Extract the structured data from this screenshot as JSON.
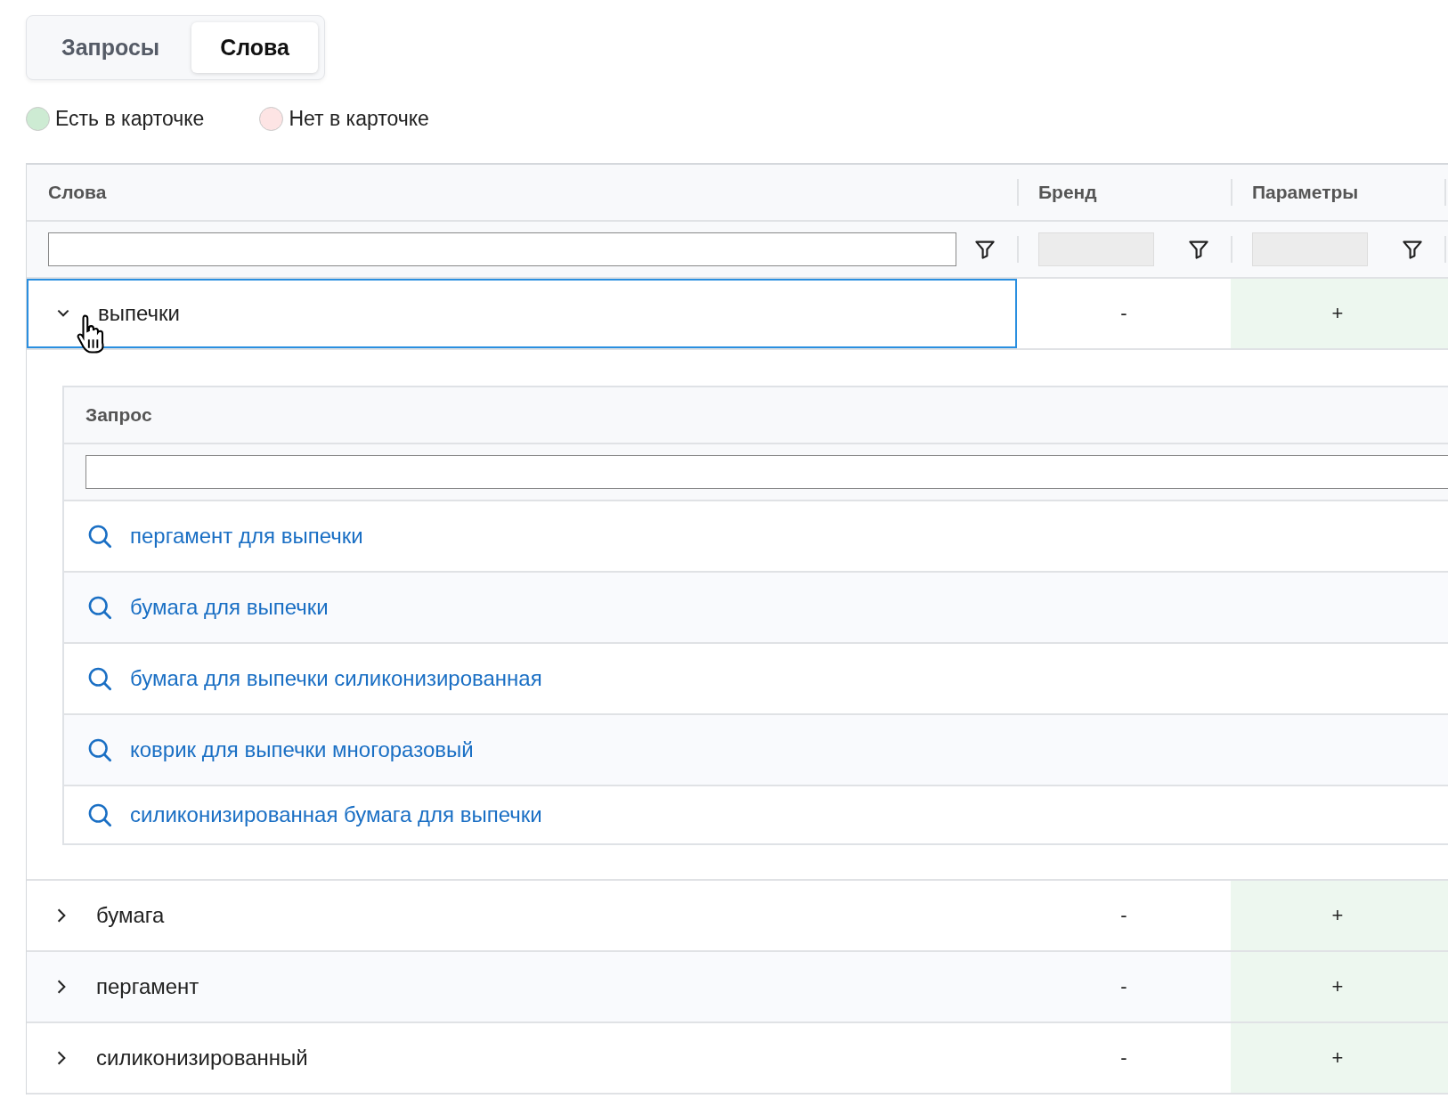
{
  "tabs": [
    {
      "label": "Запросы",
      "selected": false
    },
    {
      "label": "Слова",
      "selected": true
    }
  ],
  "legend": [
    {
      "label": "Есть в карточке",
      "color": "#cdebd3"
    },
    {
      "label": "Нет в карточке",
      "color": "#fde4e4"
    }
  ],
  "table": {
    "columns": [
      {
        "label": "Слова",
        "filter_disabled": false
      },
      {
        "label": "Бренд",
        "filter_disabled": true
      },
      {
        "label": "Параметры",
        "filter_disabled": true
      }
    ],
    "rows": [
      {
        "word": "выпечки",
        "expanded": true,
        "focused": true,
        "brand": {
          "text": "-",
          "present": false
        },
        "params": {
          "text": "+",
          "present": true
        },
        "queries": {
          "column": "Запрос",
          "items": [
            "пергамент для выпечки",
            "бумага для выпечки",
            "бумага для выпечки силиконизированная",
            "коврик для выпечки многоразовый",
            "силиконизированная бумага для выпечки"
          ]
        }
      },
      {
        "word": "бумага",
        "expanded": false,
        "focused": false,
        "brand": {
          "text": "-",
          "present": false
        },
        "params": {
          "text": "+",
          "present": true
        }
      },
      {
        "word": "пергамент",
        "expanded": false,
        "focused": false,
        "brand": {
          "text": "-",
          "present": false
        },
        "params": {
          "text": "+",
          "present": true
        }
      },
      {
        "word": "силиконизированный",
        "expanded": false,
        "focused": false,
        "brand": {
          "text": "-",
          "present": false
        },
        "params": {
          "text": "+",
          "present": true
        }
      }
    ]
  }
}
